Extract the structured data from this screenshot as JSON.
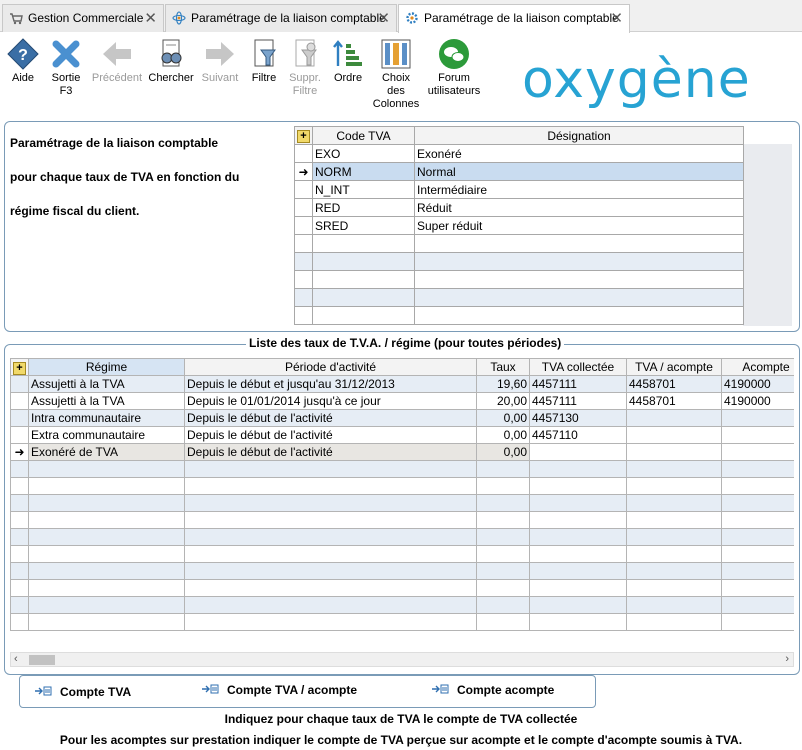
{
  "tabs": [
    {
      "label": "Gestion Commerciale",
      "close": "✕"
    },
    {
      "label": "Paramétrage de la liaison comptable",
      "close": "✕"
    },
    {
      "label": "Paramétrage de la liaison comptable",
      "close": "✕"
    }
  ],
  "toolbar": {
    "aide": "Aide",
    "sortie": "Sortie",
    "sortie_key": "F3",
    "precedent": "Précédent",
    "chercher": "Chercher",
    "suivant": "Suivant",
    "filtre": "Filtre",
    "suppr": "Suppr.",
    "suppr2": "Filtre",
    "ordre": "Ordre",
    "choix1": "Choix",
    "choix2": "des",
    "choix3": "Colonnes",
    "forum1": "Forum",
    "forum2": "utilisateurs"
  },
  "logo": "oxygène",
  "description": {
    "line1": "Paramétrage de la liaison comptable",
    "line2": "pour chaque taux de TVA en fonction du",
    "line3": "régime fiscal du client."
  },
  "tva_grid": {
    "headers": {
      "code": "Code TVA",
      "designation": "Désignation"
    },
    "rows": [
      {
        "code": "EXO",
        "designation": "Exonéré"
      },
      {
        "code": "NORM",
        "designation": "Normal"
      },
      {
        "code": "N_INT",
        "designation": "Intermédiaire"
      },
      {
        "code": "RED",
        "designation": "Réduit"
      },
      {
        "code": "SRED",
        "designation": "Super réduit"
      }
    ]
  },
  "regime_panel": {
    "title": "Liste des taux de T.V.A. / régime (pour toutes périodes)",
    "headers": {
      "regime": "Régime",
      "periode": "Période d'activité",
      "taux": "Taux",
      "tva_collectee": "TVA collectée",
      "tva_acompte": "TVA / acompte",
      "acompte": "Acompte"
    },
    "rows": [
      {
        "regime": "Assujetti à la TVA",
        "periode": "Depuis le début et jusqu'au 31/12/2013",
        "taux": "19,60",
        "tva_collectee": "4457111",
        "tva_acompte": "4458701",
        "acompte": "4190000"
      },
      {
        "regime": "Assujetti à la TVA",
        "periode": "Depuis le 01/01/2014 jusqu'à ce jour",
        "taux": "20,00",
        "tva_collectee": "4457111",
        "tva_acompte": "4458701",
        "acompte": "4190000"
      },
      {
        "regime": "Intra communautaire",
        "periode": "Depuis le début de l'activité",
        "taux": "0,00",
        "tva_collectee": "4457130",
        "tva_acompte": "",
        "acompte": ""
      },
      {
        "regime": "Extra communautaire",
        "periode": "Depuis le début de l'activité",
        "taux": "0,00",
        "tva_collectee": "4457110",
        "tva_acompte": "",
        "acompte": ""
      },
      {
        "regime": "Exonéré de TVA",
        "periode": "Depuis le début de l'activité",
        "taux": "0,00",
        "tva_collectee": "",
        "tva_acompte": "",
        "acompte": ""
      }
    ]
  },
  "buttons": {
    "compte_tva": "Compte TVA",
    "compte_tva_acompte": "Compte TVA / acompte",
    "compte_acompte": "Compte acompte"
  },
  "footer": {
    "line1": "Indiquez pour chaque taux de TVA le compte de TVA collectée",
    "line2": "Pour les acomptes sur prestation indiquer le compte de TVA perçue sur acompte et le compte d'acompte soumis à TVA."
  },
  "colors": {
    "accent": "#27a3d3",
    "panel_border": "#7a9bb7",
    "selected_row": "#c9dcf0"
  }
}
